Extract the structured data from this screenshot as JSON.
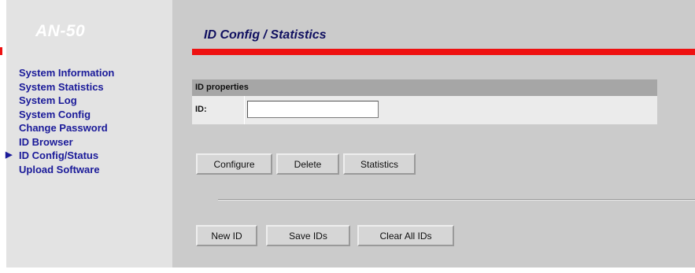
{
  "sidebar": {
    "logo": "AN-50",
    "items": [
      {
        "label": "System Information",
        "active": false
      },
      {
        "label": "System Statistics",
        "active": false
      },
      {
        "label": "System Log",
        "active": false
      },
      {
        "label": "System Config",
        "active": false
      },
      {
        "label": "Change Password",
        "active": false
      },
      {
        "label": "ID Browser",
        "active": false
      },
      {
        "label": "ID Config/Status",
        "active": true
      },
      {
        "label": "Upload Software",
        "active": false
      }
    ],
    "active_marker_icon": "right-triangle-icon"
  },
  "main": {
    "title": "ID Config / Statistics",
    "properties": {
      "header": "ID properties",
      "id_label": "ID:",
      "id_value": ""
    },
    "actions": {
      "configure": "Configure",
      "delete": "Delete",
      "statistics": "Statistics"
    },
    "bulk_actions": {
      "new_id": "New ID",
      "save_ids": "Save IDs",
      "clear_all_ids": "Clear All IDs"
    }
  },
  "colors": {
    "accent_red": "#ee1111",
    "nav_link": "#1a1a99",
    "panel_gray": "#cbcbcb",
    "sidebar_gray": "#e3e3e3"
  }
}
